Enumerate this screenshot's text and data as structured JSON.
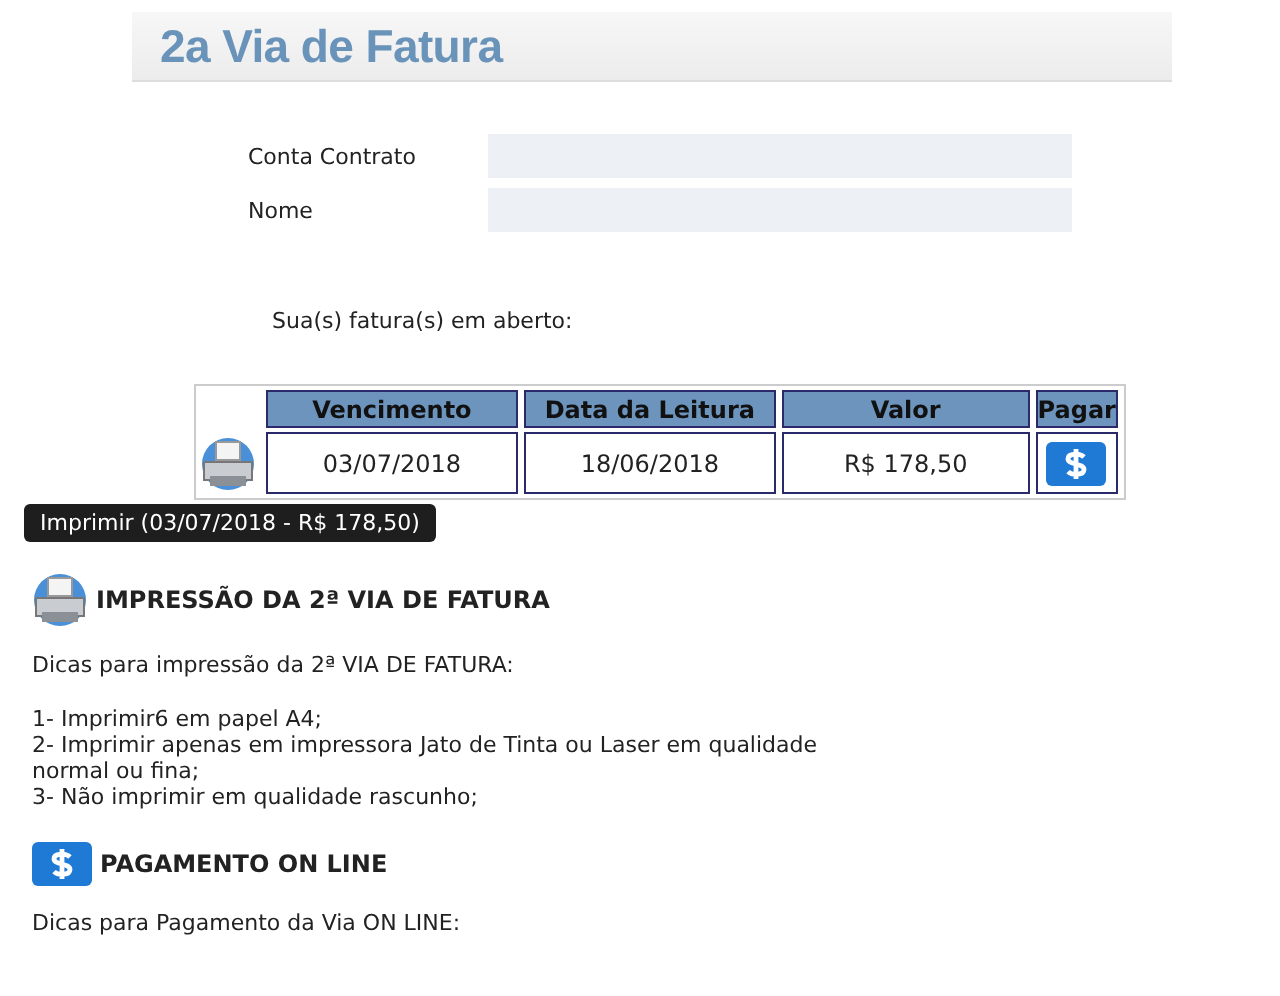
{
  "title": "2a Via de Fatura",
  "fields": [
    {
      "label": "Conta Contrato"
    },
    {
      "label": "Nome"
    }
  ],
  "open_invoices_label": "Sua(s) fatura(s) em aberto:",
  "table": {
    "columns": [
      "Vencimento",
      "Data da Leitura",
      "Valor",
      "Pagar"
    ],
    "rows": [
      {
        "due": "03/07/2018",
        "reading_date": "18/06/2018",
        "amount": "R$ 178,50"
      }
    ]
  },
  "tooltip": "Imprimir (03/07/2018 - R$ 178,50)",
  "sections": [
    {
      "kind": "print",
      "heading": "IMPRESSÃO DA 2ª VIA DE FATURA",
      "intro": "Dicas para impressão da 2ª VIA DE FATURA:",
      "lines": [
        "1- Imprimir6 em papel A4;",
        "2- Imprimir apenas em impressora Jato de Tinta ou Laser em qualidade normal ou fina;",
        "3- Não imprimir em qualidade rascunho;"
      ]
    },
    {
      "kind": "payment",
      "heading": "PAGAMENTO ON LINE",
      "intro": "Dicas para Pagamento da Via ON LINE:"
    }
  ]
}
